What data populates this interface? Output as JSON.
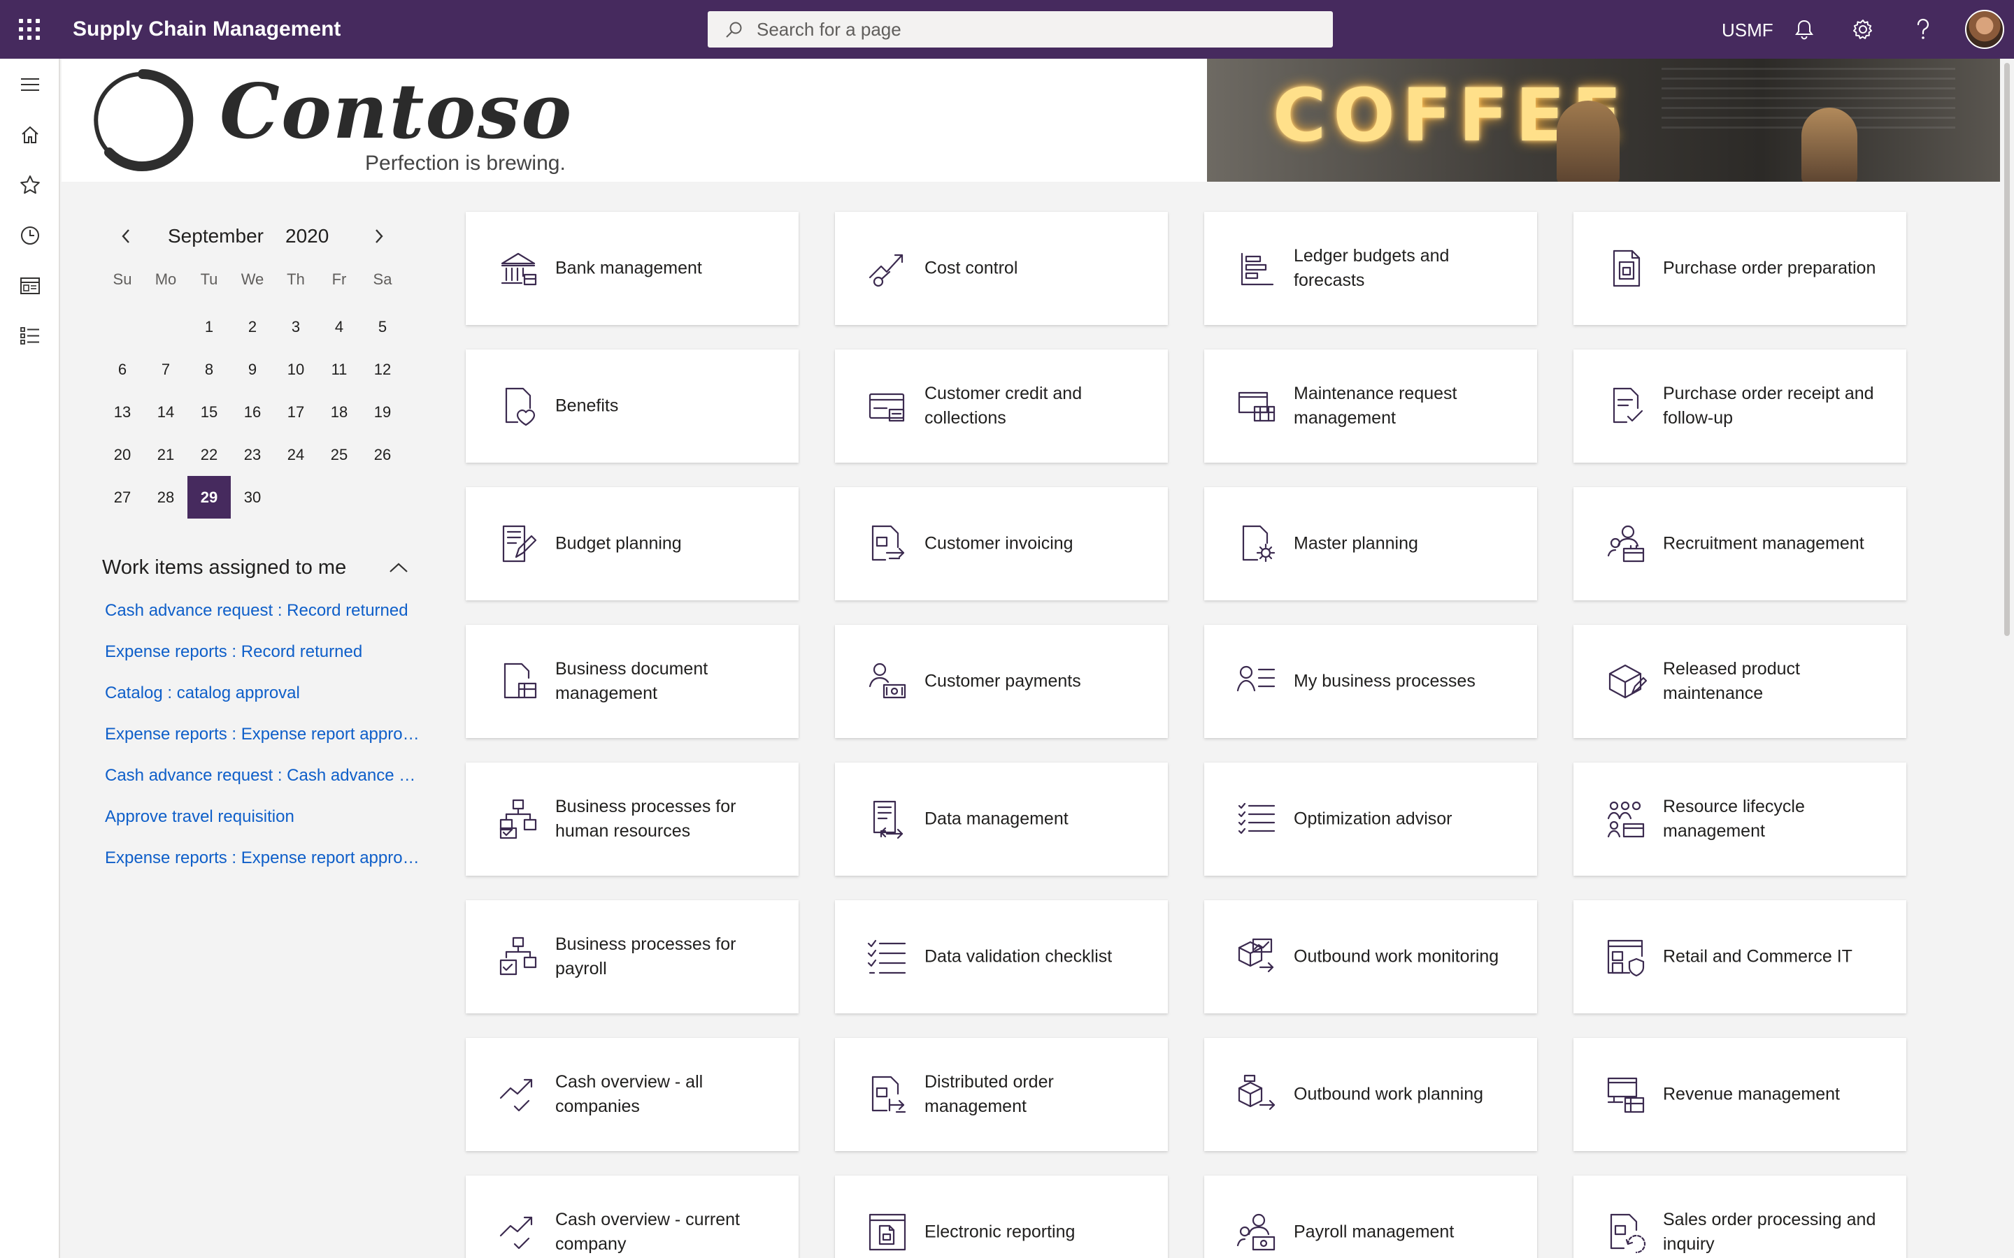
{
  "app": {
    "title": "Supply Chain Management",
    "company": "USMF"
  },
  "search": {
    "placeholder": "Search for a page"
  },
  "colors": {
    "brand": "#462a5e",
    "link": "#0f5fc9",
    "tile_icon": "#3b2a4f"
  },
  "topbar_icons": [
    "waffle-icon",
    "search-icon",
    "bell-icon",
    "gear-icon",
    "help-icon",
    "avatar"
  ],
  "leftnav_icons": [
    "hamburger-icon",
    "home-icon",
    "star-icon",
    "clock-icon",
    "workspace-icon",
    "list-icon"
  ],
  "banner": {
    "logo_word": "Contoso",
    "tagline": "Perfection is brewing.",
    "image_text": "COFFEE"
  },
  "calendar": {
    "month": "September",
    "year": "2020",
    "days_of_week": [
      "Su",
      "Mo",
      "Tu",
      "We",
      "Th",
      "Fr",
      "Sa"
    ],
    "leading_blanks": 2,
    "days": [
      "1",
      "2",
      "3",
      "4",
      "5",
      "6",
      "7",
      "8",
      "9",
      "10",
      "11",
      "12",
      "13",
      "14",
      "15",
      "16",
      "17",
      "18",
      "19",
      "20",
      "21",
      "22",
      "23",
      "24",
      "25",
      "26",
      "27",
      "28",
      "29",
      "30"
    ],
    "selected": "29"
  },
  "work_items": {
    "title": "Work items assigned to me",
    "links": [
      "Cash advance request : Record returned",
      "Expense reports : Record returned",
      "Catalog : catalog approval",
      "Expense reports : Expense report approval",
      "Cash advance request : Cash advance approval",
      "Approve travel requisition",
      "Expense reports : Expense report approval"
    ]
  },
  "tiles": [
    {
      "label": "Bank management",
      "icon": "bank-icon"
    },
    {
      "label": "Cost control",
      "icon": "cost-control-icon"
    },
    {
      "label": "Ledger budgets and forecasts",
      "icon": "ledger-budget-icon"
    },
    {
      "label": "Purchase order preparation",
      "icon": "purchase-order-icon"
    },
    {
      "label": "Benefits",
      "icon": "benefits-icon"
    },
    {
      "label": "Customer credit and collections",
      "icon": "credit-card-icon"
    },
    {
      "label": "Maintenance request management",
      "icon": "maintenance-icon"
    },
    {
      "label": "Purchase order receipt and follow-up",
      "icon": "receipt-check-icon"
    },
    {
      "label": "Budget planning",
      "icon": "budget-planning-icon"
    },
    {
      "label": "Customer invoicing",
      "icon": "invoice-icon"
    },
    {
      "label": "Master planning",
      "icon": "planning-gear-icon"
    },
    {
      "label": "Recruitment management",
      "icon": "recruitment-icon"
    },
    {
      "label": "Business document management",
      "icon": "document-management-icon"
    },
    {
      "label": "Customer payments",
      "icon": "customer-payment-icon"
    },
    {
      "label": "My business processes",
      "icon": "business-process-icon"
    },
    {
      "label": "Released product maintenance",
      "icon": "product-box-icon"
    },
    {
      "label": "Business processes for human resources",
      "icon": "hr-process-icon"
    },
    {
      "label": "Data management",
      "icon": "data-management-icon"
    },
    {
      "label": "Optimization advisor",
      "icon": "checklist-icon"
    },
    {
      "label": "Resource lifecycle management",
      "icon": "resource-lifecycle-icon"
    },
    {
      "label": "Business processes for payroll",
      "icon": "payroll-process-icon"
    },
    {
      "label": "Data validation checklist",
      "icon": "validation-checklist-icon"
    },
    {
      "label": "Outbound work monitoring",
      "icon": "outbound-monitor-icon"
    },
    {
      "label": "Retail and Commerce IT",
      "icon": "store-shield-icon"
    },
    {
      "label": "Cash overview - all companies",
      "icon": "trend-check-icon"
    },
    {
      "label": "Distributed order management",
      "icon": "distributed-order-icon"
    },
    {
      "label": "Outbound work planning",
      "icon": "outbound-planning-icon"
    },
    {
      "label": "Revenue management",
      "icon": "revenue-icon"
    },
    {
      "label": "Cash overview - current company",
      "icon": "trend-check-icon"
    },
    {
      "label": "Electronic reporting",
      "icon": "electronic-report-icon"
    },
    {
      "label": "Payroll management",
      "icon": "payroll-people-icon"
    },
    {
      "label": "Sales order processing and inquiry",
      "icon": "sales-order-icon"
    }
  ]
}
